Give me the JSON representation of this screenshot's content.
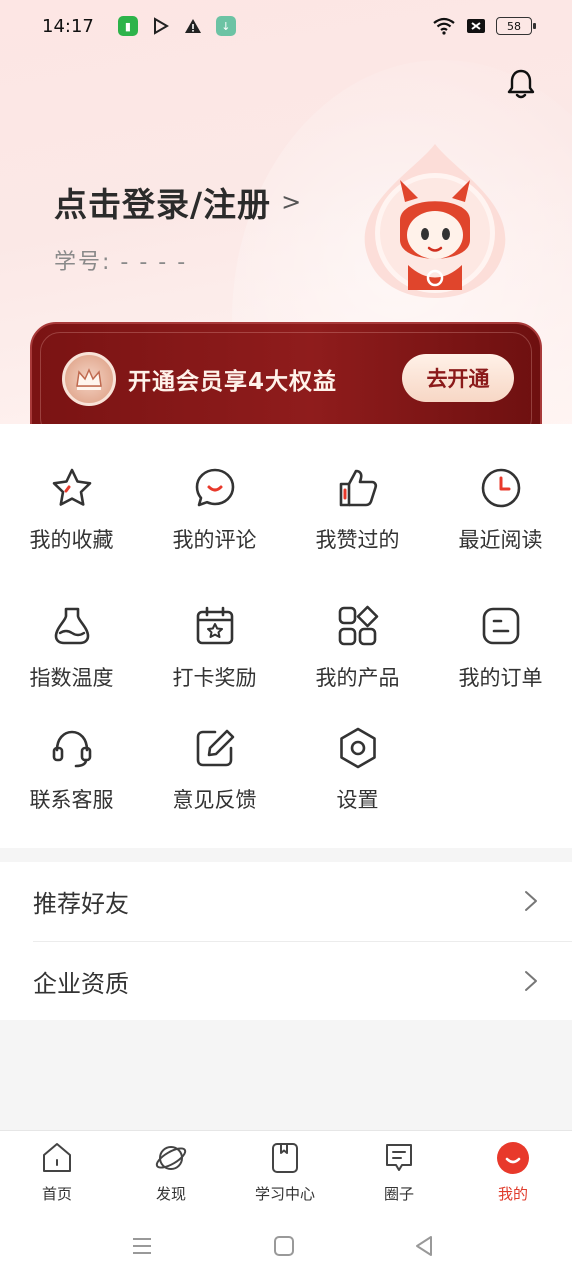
{
  "status_bar": {
    "time": "14:17",
    "battery": "58"
  },
  "header": {
    "login_text": "点击登录/注册",
    "login_chevron": ">",
    "student_id_label": "学号:",
    "student_id_value": "- - - -",
    "bell_icon": "bell-icon"
  },
  "vip": {
    "text": "开通会员享4大权益",
    "button": "去开通"
  },
  "grid": {
    "items": [
      {
        "label": "我的收藏",
        "icon": "star-icon"
      },
      {
        "label": "我的评论",
        "icon": "comment-icon"
      },
      {
        "label": "我赞过的",
        "icon": "thumbs-up-icon"
      },
      {
        "label": "最近阅读",
        "icon": "clock-icon"
      },
      {
        "label": "指数温度",
        "icon": "flask-icon"
      },
      {
        "label": "打卡奖励",
        "icon": "calendar-star-icon"
      },
      {
        "label": "我的产品",
        "icon": "apps-icon"
      },
      {
        "label": "我的订单",
        "icon": "order-icon"
      },
      {
        "label": "联系客服",
        "icon": "headset-icon"
      },
      {
        "label": "意见反馈",
        "icon": "edit-icon"
      },
      {
        "label": "设置",
        "icon": "settings-icon"
      }
    ]
  },
  "list": {
    "items": [
      {
        "label": "推荐好友"
      },
      {
        "label": "企业资质"
      }
    ]
  },
  "tabs": {
    "items": [
      {
        "label": "首页",
        "icon": "home-icon"
      },
      {
        "label": "发现",
        "icon": "planet-icon"
      },
      {
        "label": "学习中心",
        "icon": "book-icon"
      },
      {
        "label": "圈子",
        "icon": "chat-icon"
      },
      {
        "label": "我的",
        "icon": "mine-icon",
        "active": true
      }
    ]
  },
  "colors": {
    "accent": "#e03c2c",
    "vip_bg": "#8f1c1c",
    "icon_red": "#e8392b",
    "icon_dark": "#333333"
  }
}
